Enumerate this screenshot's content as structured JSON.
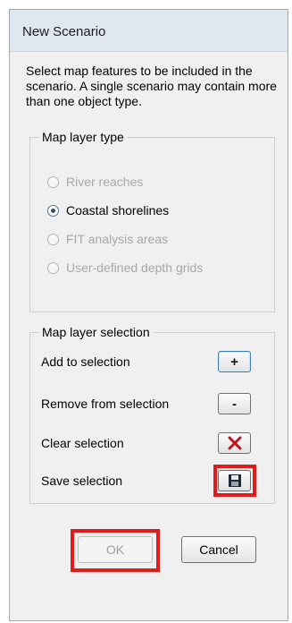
{
  "window": {
    "title": "New Scenario"
  },
  "intro": "Select map features to be included in the scenario.  A single scenario may contain more than one object type.",
  "map_layer_type": {
    "title": "Map layer type",
    "options": [
      {
        "label": "River reaches",
        "enabled": false,
        "checked": false
      },
      {
        "label": "Coastal shorelines",
        "enabled": true,
        "checked": true
      },
      {
        "label": "FIT analysis areas",
        "enabled": false,
        "checked": false
      },
      {
        "label": "User-defined depth grids",
        "enabled": false,
        "checked": false
      }
    ]
  },
  "map_layer_selection": {
    "title": "Map layer selection",
    "add_label": "Add to selection",
    "add_symbol": "+",
    "remove_label": "Remove from selection",
    "remove_symbol": "-",
    "clear_label": "Clear selection",
    "save_label": "Save selection"
  },
  "buttons": {
    "ok": "OK",
    "cancel": "Cancel"
  },
  "colors": {
    "highlight": "#e21b1b",
    "clear_x": "#c0141c",
    "accent": "#3c7fb1"
  }
}
